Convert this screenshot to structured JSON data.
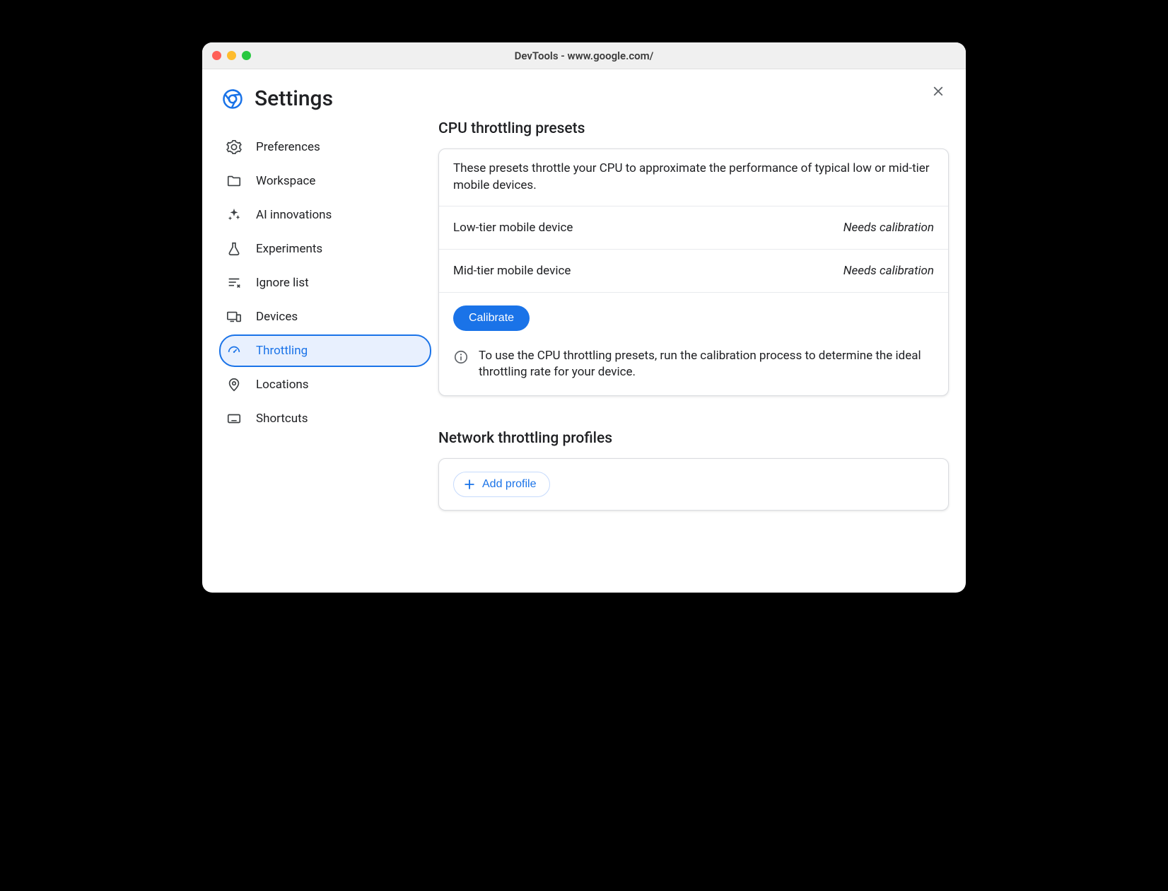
{
  "window": {
    "title": "DevTools - www.google.com/"
  },
  "header": {
    "title": "Settings"
  },
  "sidebar": {
    "items": [
      {
        "label": "Preferences"
      },
      {
        "label": "Workspace"
      },
      {
        "label": "AI innovations"
      },
      {
        "label": "Experiments"
      },
      {
        "label": "Ignore list"
      },
      {
        "label": "Devices"
      },
      {
        "label": "Throttling"
      },
      {
        "label": "Locations"
      },
      {
        "label": "Shortcuts"
      }
    ]
  },
  "cpu": {
    "title": "CPU throttling presets",
    "description": "These presets throttle your CPU to approximate the performance of typical low or mid-tier mobile devices.",
    "presets": [
      {
        "name": "Low-tier mobile device",
        "status": "Needs calibration"
      },
      {
        "name": "Mid-tier mobile device",
        "status": "Needs calibration"
      }
    ],
    "calibrate_label": "Calibrate",
    "info": "To use the CPU throttling presets, run the calibration process to determine the ideal throttling rate for your device."
  },
  "network": {
    "title": "Network throttling profiles",
    "add_profile_label": "Add profile"
  }
}
